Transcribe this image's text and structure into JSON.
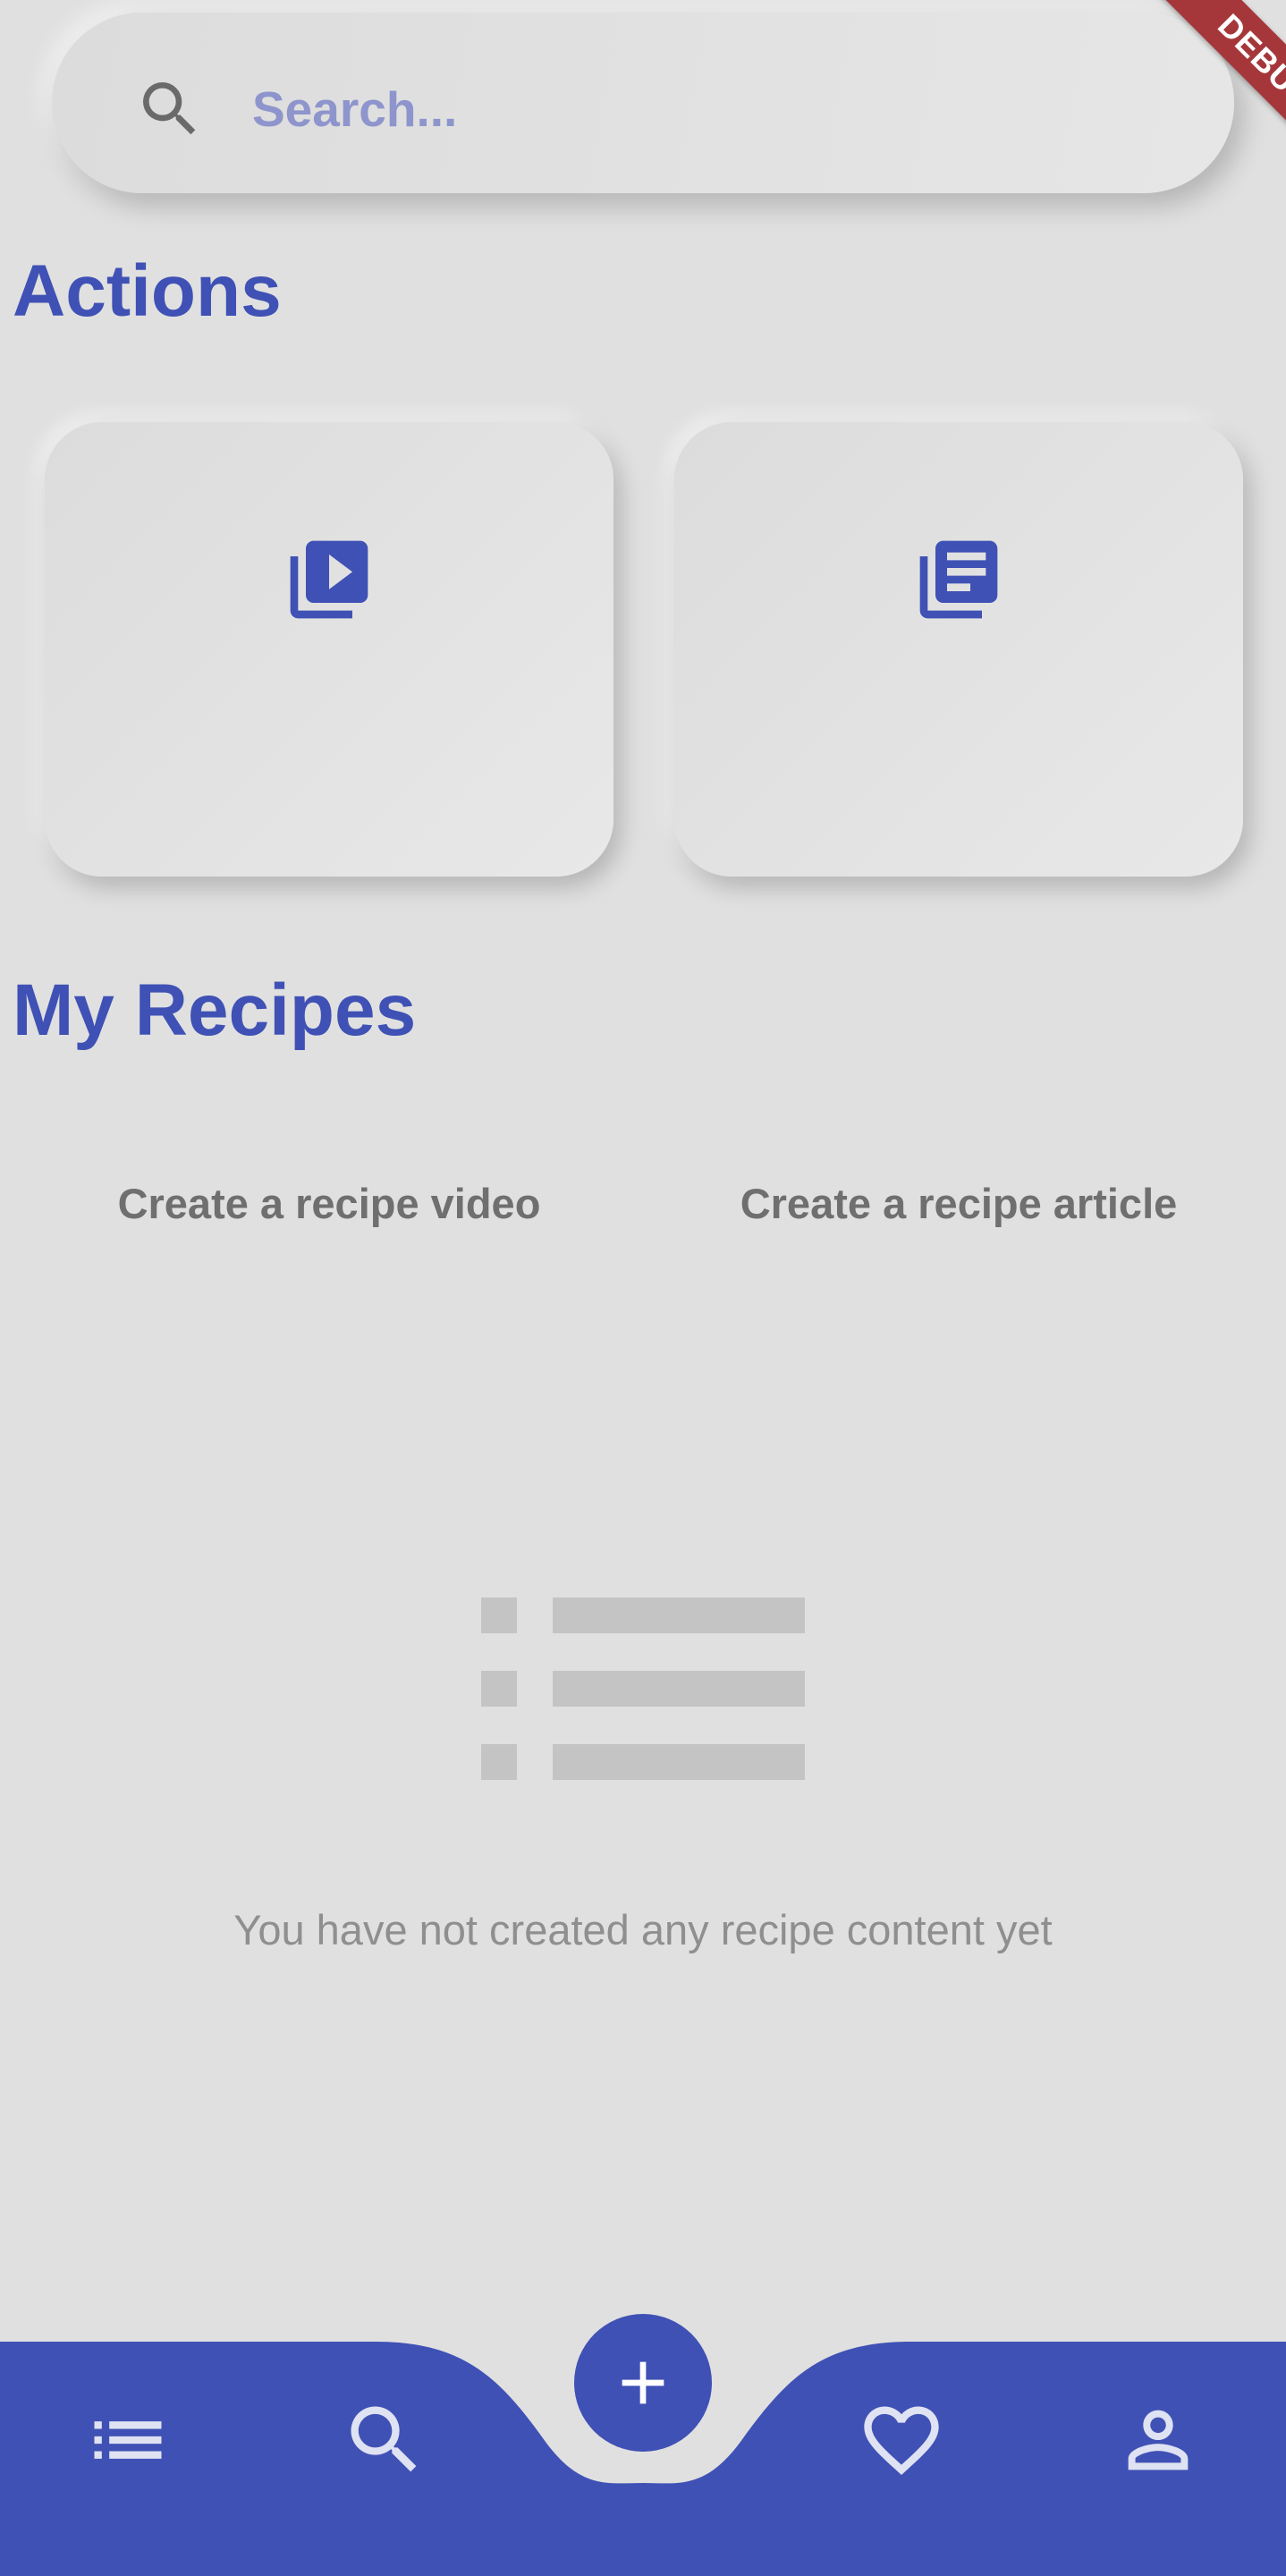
{
  "search": {
    "placeholder": "Search...",
    "icon": "search-icon"
  },
  "debug_banner": {
    "label": "DEBUG",
    "color": "#a5373a"
  },
  "actions": {
    "title": "Actions",
    "cards": [
      {
        "label": "Create a recipe video",
        "icon": "video-library-icon"
      },
      {
        "label": "Create a recipe article",
        "icon": "article-library-icon"
      }
    ]
  },
  "my_recipes": {
    "title": "My Recipes",
    "empty_icon": "empty-list-icon",
    "empty_message": "You have not created any recipe content yet"
  },
  "bottom_nav": {
    "items": [
      {
        "name": "list",
        "icon": "list-icon"
      },
      {
        "name": "search",
        "icon": "search-icon"
      },
      {
        "name": "add",
        "icon": "add-icon"
      },
      {
        "name": "favorites",
        "icon": "heart-icon"
      },
      {
        "name": "profile",
        "icon": "person-icon"
      }
    ]
  },
  "colors": {
    "accent": "#3f51b5",
    "background": "#e0e0e0",
    "placeholder": "#8e95cc",
    "muted_text": "#8f8f8f",
    "card_text": "#6f6f6f",
    "nav_icon": "#dfe2f2"
  }
}
